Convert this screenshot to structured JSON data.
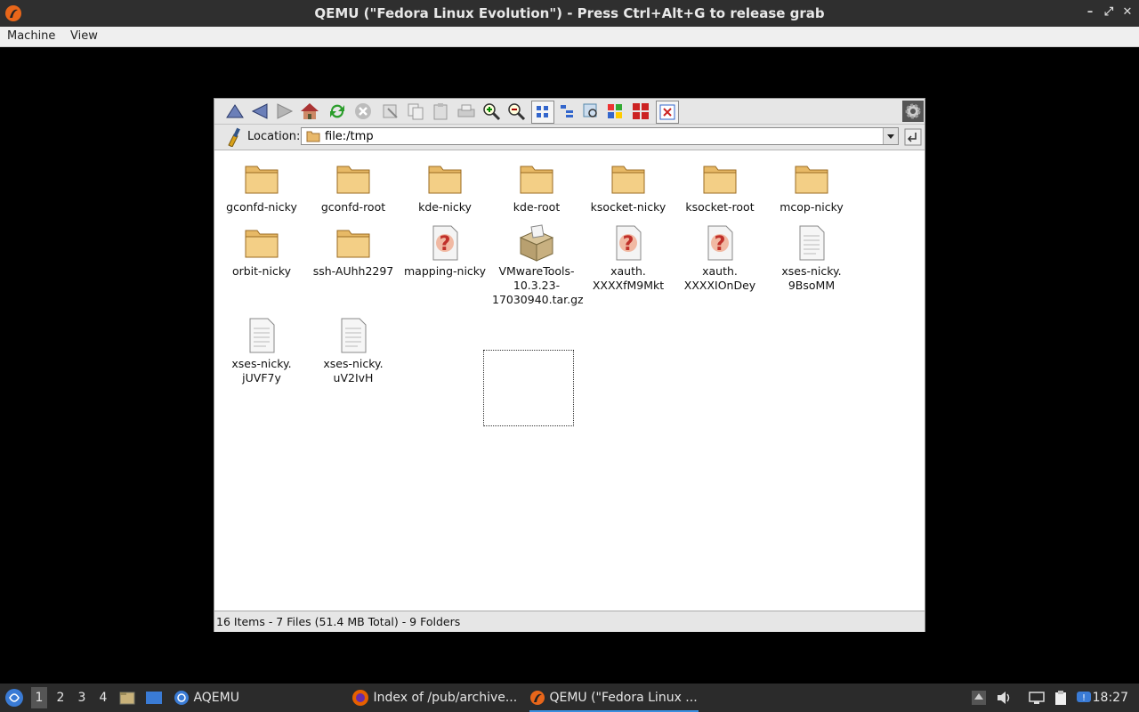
{
  "window": {
    "title": "QEMU (\"Fedora Linux Evolution\") - Press Ctrl+Alt+G to release grab",
    "menu": [
      "Machine",
      "View"
    ]
  },
  "konqueror": {
    "toolbar": [
      "up-icon",
      "back-icon",
      "forward-icon",
      "home-icon",
      "reload-icon",
      "stop-icon",
      "cut-icon",
      "copy-icon",
      "paste-icon",
      "print-icon",
      "zoom-in-icon",
      "zoom-out-icon",
      "icon-view-icon",
      "tree-view-icon",
      "preview-icon",
      "detailed-view-icon",
      "split-view-icon",
      "close-split-icon",
      "konqueror-gear-icon"
    ],
    "location_label": "Location:",
    "location_value": "file:/tmp",
    "items": [
      {
        "name": "gconfd-nicky",
        "type": "folder"
      },
      {
        "name": "gconfd-root",
        "type": "folder"
      },
      {
        "name": "kde-nicky",
        "type": "folder"
      },
      {
        "name": "kde-root",
        "type": "folder"
      },
      {
        "name": "ksocket-nicky",
        "type": "folder"
      },
      {
        "name": "ksocket-root",
        "type": "folder"
      },
      {
        "name": "mcop-nicky",
        "type": "folder"
      },
      {
        "name": "orbit-nicky",
        "type": "folder"
      },
      {
        "name": "ssh-AUhh2297",
        "type": "folder"
      },
      {
        "name": "mapping-nicky",
        "type": "unknown"
      },
      {
        "name": "VMwareTools-\n10.3.23-\n17030940.tar.gz",
        "type": "archive"
      },
      {
        "name": "xauth.\nXXXXfM9Mkt",
        "type": "unknown"
      },
      {
        "name": "xauth.\nXXXXIOnDey",
        "type": "unknown"
      },
      {
        "name": "xses-nicky.\n9BsoMM",
        "type": "text"
      },
      {
        "name": "xses-nicky.\njUVF7y",
        "type": "text"
      },
      {
        "name": "xses-nicky.\nuV2IvH",
        "type": "text"
      }
    ],
    "status": "16 Items - 7 Files (51.4 MB Total) - 9 Folders"
  },
  "taskbar": {
    "workspaces": [
      "1",
      "2",
      "3",
      "4"
    ],
    "active_workspace": "1",
    "tasks": [
      {
        "label": "AQEMU",
        "icon": "aqemu-icon"
      },
      {
        "label": "Index of /pub/archive...",
        "icon": "firefox-icon"
      },
      {
        "label": "QEMU (\"Fedora Linux ...",
        "icon": "qemu-icon"
      }
    ],
    "clock": "18:27"
  }
}
